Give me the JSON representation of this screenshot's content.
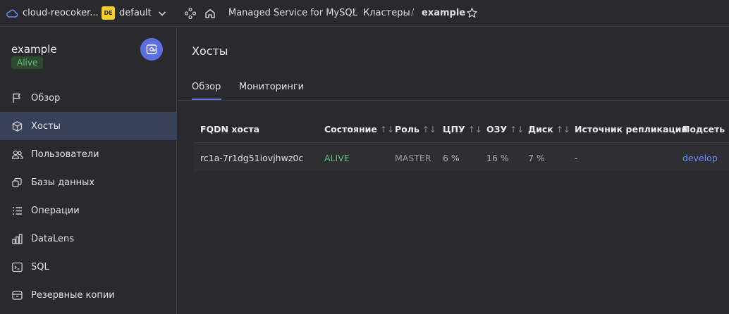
{
  "topbar": {
    "cloud_label": "cloud-reocoker...",
    "folder_badge": "DE",
    "folder_label": "default",
    "breadcrumbs": [
      "Managed Service for MySQL",
      "Кластеры",
      "example"
    ],
    "separator": "/"
  },
  "sidebar": {
    "cluster_name": "example",
    "status": "Alive",
    "items": [
      {
        "label": "Обзор",
        "icon": "flag-icon"
      },
      {
        "label": "Хосты",
        "icon": "cube-icon"
      },
      {
        "label": "Пользователи",
        "icon": "users-icon"
      },
      {
        "label": "Базы данных",
        "icon": "databases-icon"
      },
      {
        "label": "Операции",
        "icon": "list-icon"
      },
      {
        "label": "DataLens",
        "icon": "chart-icon"
      },
      {
        "label": "SQL",
        "icon": "terminal-icon"
      },
      {
        "label": "Резервные копии",
        "icon": "backup-icon"
      }
    ],
    "active_index": 1
  },
  "main": {
    "title": "Хосты",
    "tabs": [
      "Обзор",
      "Мониторинги"
    ],
    "table": {
      "columns": [
        "FQDN хоста",
        "Состояние",
        "Роль",
        "ЦПУ",
        "ОЗУ",
        "Диск",
        "Источник репликации",
        "Подсеть"
      ],
      "sort_glyph": "↑↓",
      "rows": [
        {
          "fqdn": "rc1a-7r1dg51iovjhwz0c",
          "state": "ALIVE",
          "role": "MASTER",
          "cpu": "6 %",
          "ram": "16 %",
          "disk": "7 %",
          "replication_source": "-",
          "subnet": "develop"
        }
      ]
    }
  },
  "colors": {
    "background": "#2a2a2e",
    "accent": "#5e7ce0",
    "alive": "#5fc26a",
    "link": "#6b8cff",
    "folder_badge": "#f6cf2f"
  }
}
